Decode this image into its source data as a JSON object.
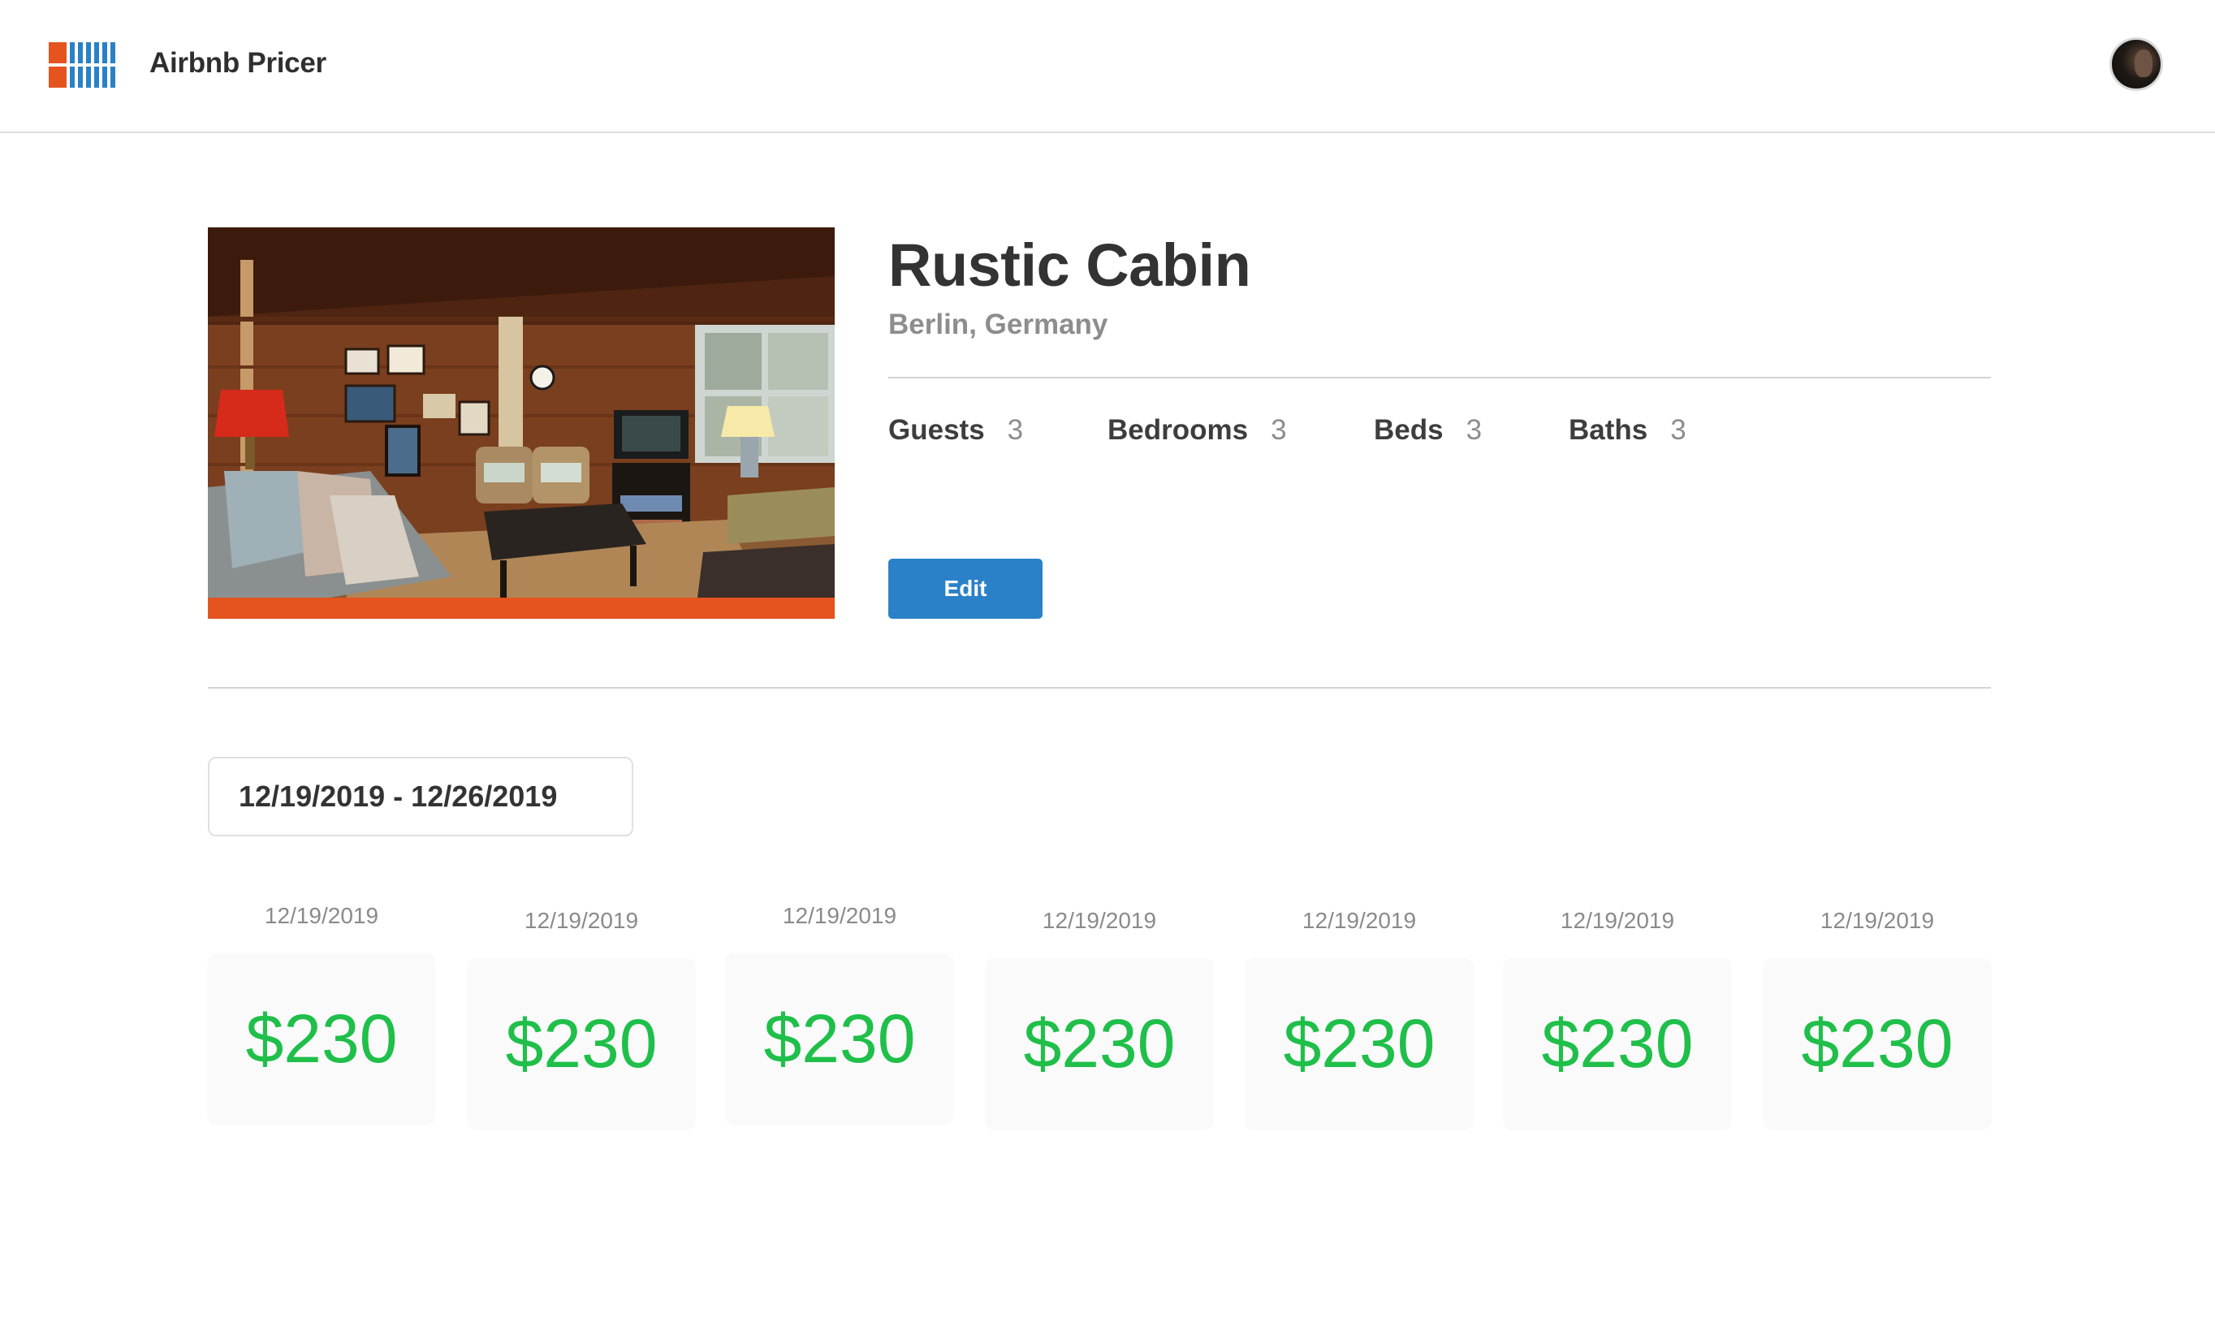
{
  "app": {
    "title": "Airbnb Pricer",
    "logo_icon": "app-logo-icon",
    "avatar_icon": "user-avatar-icon",
    "colors": {
      "brand_orange": "#e5531f",
      "brand_blue": "#2a81c7",
      "price_green": "#1fbf4a"
    }
  },
  "listing": {
    "title": "Rustic Cabin",
    "location": "Berlin, Germany",
    "photo_description": "listing-photo",
    "stats": [
      {
        "label": "Guests",
        "value": "3"
      },
      {
        "label": "Bedrooms",
        "value": "3"
      },
      {
        "label": "Beds",
        "value": "3"
      },
      {
        "label": "Baths",
        "value": "3"
      }
    ],
    "edit_label": "Edit"
  },
  "date_range": {
    "value": "12/19/2019 - 12/26/2019"
  },
  "prices": [
    {
      "date": "12/19/2019",
      "price": "$230"
    },
    {
      "date": "12/19/2019",
      "price": "$230"
    },
    {
      "date": "12/19/2019",
      "price": "$230"
    },
    {
      "date": "12/19/2019",
      "price": "$230"
    },
    {
      "date": "12/19/2019",
      "price": "$230"
    },
    {
      "date": "12/19/2019",
      "price": "$230"
    },
    {
      "date": "12/19/2019",
      "price": "$230"
    }
  ]
}
